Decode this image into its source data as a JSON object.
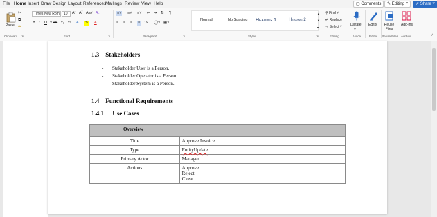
{
  "menubar": {
    "tabs": [
      "File",
      "Home",
      "Insert",
      "Draw",
      "Design",
      "Layout",
      "References",
      "Mailings",
      "Review",
      "View",
      "Help"
    ],
    "active_tab": "Home",
    "comments_label": "Comments",
    "editing_label": "Editing",
    "share_label": "Share"
  },
  "ribbon": {
    "clipboard": {
      "paste_label": "Paste",
      "group_label": "Clipboard"
    },
    "font": {
      "font_name": "Times New Roman",
      "font_size": "10",
      "group_label": "Font"
    },
    "paragraph": {
      "group_label": "Paragraph"
    },
    "styles": {
      "items": [
        "Normal",
        "No Spacing",
        "Heading 1",
        "Heading 2"
      ],
      "group_label": "Styles"
    },
    "editing": {
      "find_label": "Find",
      "replace_label": "Replace",
      "select_label": "Select",
      "group_label": "Editing"
    },
    "voice": {
      "dictate_label": "Dictate",
      "group_label": "Voice"
    },
    "editor": {
      "label": "Editor",
      "group_label": "Editor"
    },
    "reuse": {
      "label": "Reuse Files",
      "group_label": "Reuse Files"
    },
    "addins": {
      "label": "Add-ins",
      "group_label": "Add-ins"
    }
  },
  "document": {
    "section_1_3": {
      "number": "1.3",
      "title": "Stakeholders"
    },
    "bullets": [
      "Stakeholder User is a Person.",
      "Stakeholder Operator is a Person.",
      "Stakeholder System is a Person."
    ],
    "section_1_4": {
      "number": "1.4",
      "title": "Functional Requirements"
    },
    "section_1_4_1": {
      "number": "1.4.1",
      "title": "Use Cases"
    },
    "table": {
      "header": "Overview",
      "rows": [
        {
          "label": "Title",
          "value": "Approve Invoice"
        },
        {
          "label": "Type",
          "value": "EntityUpdate"
        },
        {
          "label": "Primary Actor",
          "value": "Manager"
        },
        {
          "label": "Actions",
          "values": [
            "Approve",
            "Reject",
            "Close"
          ]
        }
      ]
    }
  }
}
